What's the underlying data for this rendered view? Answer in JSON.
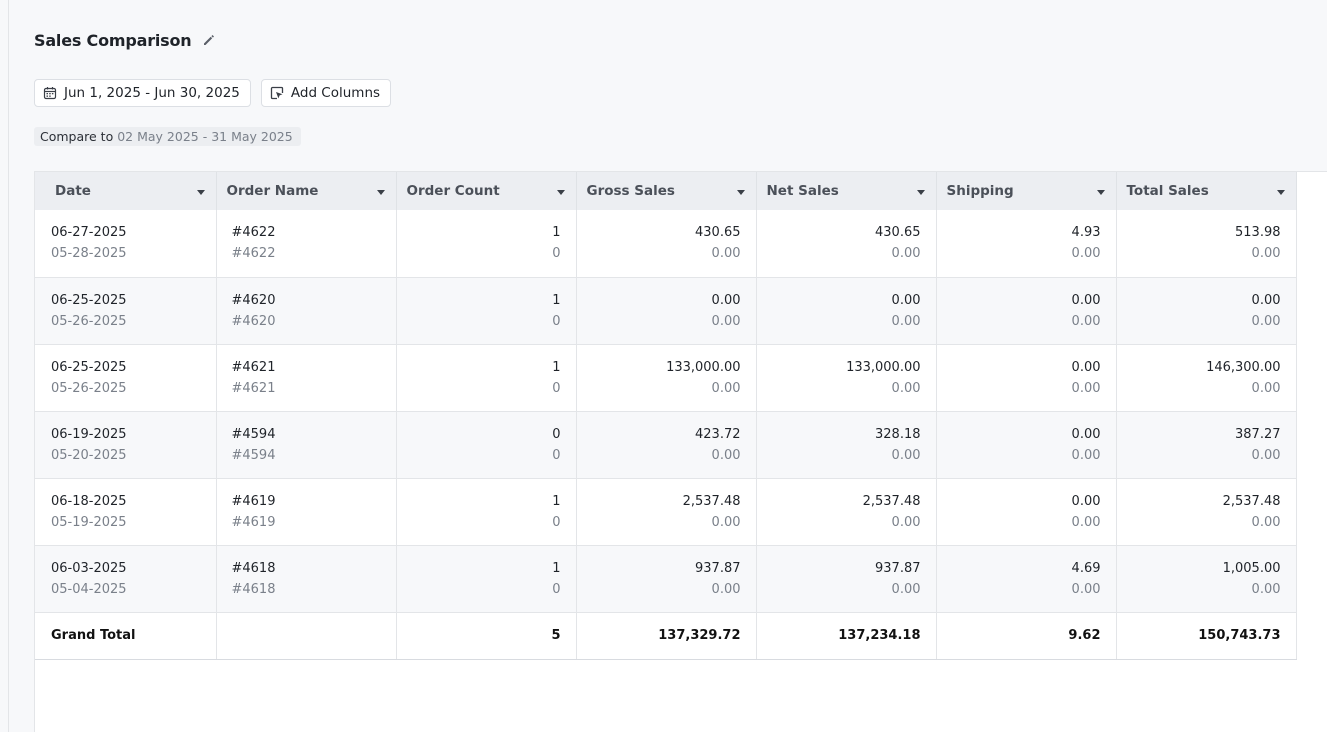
{
  "page": {
    "title": "Sales Comparison"
  },
  "toolbar": {
    "date_range": "Jun 1, 2025 - Jun 30, 2025",
    "add_columns": "Add Columns"
  },
  "compare": {
    "label": "Compare to",
    "value": "02 May 2025 - 31 May 2025"
  },
  "table": {
    "columns": [
      "Date",
      "Order Name",
      "Order Count",
      "Gross Sales",
      "Net Sales",
      "Shipping",
      "Total Sales"
    ],
    "rows": [
      {
        "date": "06-27-2025",
        "date_prev": "05-28-2025",
        "order": "#4622",
        "order_prev": "#4622",
        "count": "1",
        "count_prev": "0",
        "gross": "430.65",
        "gross_prev": "0.00",
        "net": "430.65",
        "net_prev": "0.00",
        "shipping": "4.93",
        "shipping_prev": "0.00",
        "total": "513.98",
        "total_prev": "0.00"
      },
      {
        "date": "06-25-2025",
        "date_prev": "05-26-2025",
        "order": "#4620",
        "order_prev": "#4620",
        "count": "1",
        "count_prev": "0",
        "gross": "0.00",
        "gross_prev": "0.00",
        "net": "0.00",
        "net_prev": "0.00",
        "shipping": "0.00",
        "shipping_prev": "0.00",
        "total": "0.00",
        "total_prev": "0.00"
      },
      {
        "date": "06-25-2025",
        "date_prev": "05-26-2025",
        "order": "#4621",
        "order_prev": "#4621",
        "count": "1",
        "count_prev": "0",
        "gross": "133,000.00",
        "gross_prev": "0.00",
        "net": "133,000.00",
        "net_prev": "0.00",
        "shipping": "0.00",
        "shipping_prev": "0.00",
        "total": "146,300.00",
        "total_prev": "0.00"
      },
      {
        "date": "06-19-2025",
        "date_prev": "05-20-2025",
        "order": "#4594",
        "order_prev": "#4594",
        "count": "0",
        "count_prev": "0",
        "gross": "423.72",
        "gross_prev": "0.00",
        "net": "328.18",
        "net_prev": "0.00",
        "shipping": "0.00",
        "shipping_prev": "0.00",
        "total": "387.27",
        "total_prev": "0.00"
      },
      {
        "date": "06-18-2025",
        "date_prev": "05-19-2025",
        "order": "#4619",
        "order_prev": "#4619",
        "count": "1",
        "count_prev": "0",
        "gross": "2,537.48",
        "gross_prev": "0.00",
        "net": "2,537.48",
        "net_prev": "0.00",
        "shipping": "0.00",
        "shipping_prev": "0.00",
        "total": "2,537.48",
        "total_prev": "0.00"
      },
      {
        "date": "06-03-2025",
        "date_prev": "05-04-2025",
        "order": "#4618",
        "order_prev": "#4618",
        "count": "1",
        "count_prev": "0",
        "gross": "937.87",
        "gross_prev": "0.00",
        "net": "937.87",
        "net_prev": "0.00",
        "shipping": "4.69",
        "shipping_prev": "0.00",
        "total": "1,005.00",
        "total_prev": "0.00"
      }
    ],
    "footer": {
      "label": "Grand Total",
      "order": "",
      "count": "5",
      "gross": "137,329.72",
      "net": "137,234.18",
      "shipping": "9.62",
      "total": "150,743.73"
    }
  },
  "icons": {
    "edit": "pencil-icon",
    "calendar": "calendar-icon",
    "add_columns": "add-columns-icon",
    "sort": "caret-down-icon"
  }
}
